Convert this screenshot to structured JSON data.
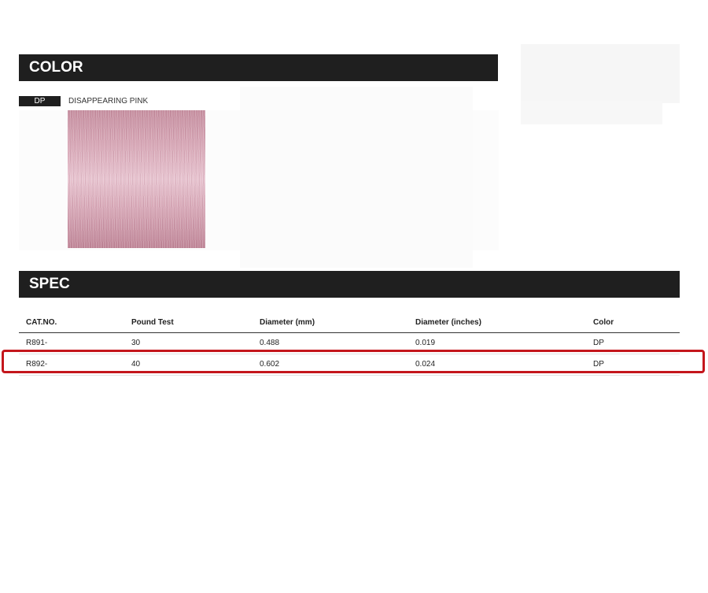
{
  "color_section": {
    "title": "COLOR",
    "swatch": {
      "code": "DP",
      "name": "DISAPPEARING PINK",
      "color": "#d7a7b6"
    }
  },
  "spec_section": {
    "title": "SPEC",
    "columns": [
      "CAT.NO.",
      "Pound Test",
      "Diameter (mm)",
      "Diameter (inches)",
      "Color"
    ],
    "rows": [
      [
        "R891-",
        "30",
        "0.488",
        "0.019",
        "DP"
      ],
      [
        "R892-",
        "40",
        "0.602",
        "0.024",
        "DP"
      ]
    ],
    "highlight_color": "#c4161c"
  }
}
